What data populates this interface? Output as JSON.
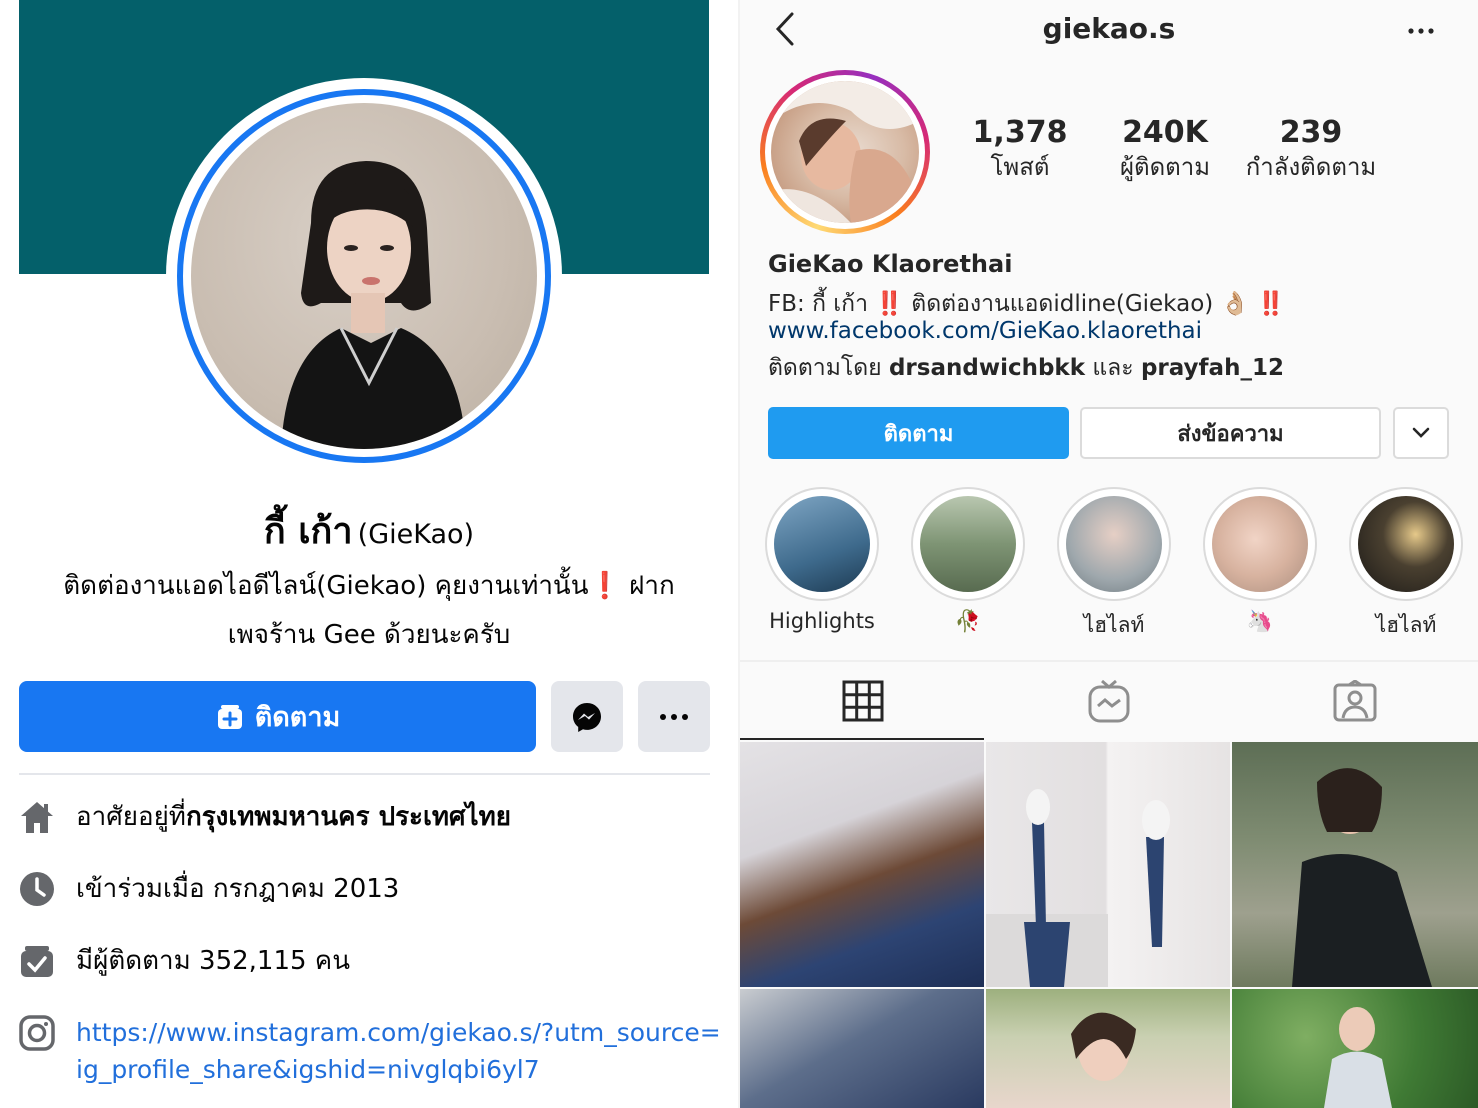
{
  "facebook": {
    "name_th": "กี้ เก้า",
    "name_en": "(GieKao)",
    "bio_line1": "ติดต่องานแอดไอดีไลน์(Giekao) คุยงานเท่านั้น❗ ฝาก",
    "bio_line2": "เพจร้าน Gee ด้วยนะครับ",
    "follow_label": "ติดตาม",
    "lives_prefix": "อาศัยอยู่ที่ ",
    "lives_place": "กรุงเทพมหานคร ประเทศไทย",
    "joined": "เข้าร่วมเมื่อ กรกฎาคม  2013",
    "followers": "มีผู้ติดตาม 352,115 คน",
    "instagram_link": "https://www.instagram.com/giekao.s/?utm_source=ig_profile_share&igshid=nivglqbi6yl7",
    "colors": {
      "cover": "#04606a",
      "accent": "#1877f2"
    }
  },
  "instagram": {
    "username": "giekao.s",
    "stats": [
      {
        "value": "1,378",
        "label": "โพสต์"
      },
      {
        "value": "240K",
        "label": "ผู้ติดตาม"
      },
      {
        "value": "239",
        "label": "กำลังติดตาม"
      }
    ],
    "display_name": "GieKao Klaorethai",
    "bio_prefix": "FB: กี้ เก้า ",
    "bio_bang1": "‼️",
    "bio_middle": " ติดต่องานแอดidline(Giekao) 👌🏼 ",
    "bio_bang2": "‼️",
    "url": "www.facebook.com/GieKao.klaorethai",
    "followed_prefix": "ติดตามโดย ",
    "followed_user1": "drsandwichbkk",
    "followed_and": " และ ",
    "followed_user2": "prayfah_12",
    "follow_label": "ติดตาม",
    "message_label": "ส่งข้อความ",
    "highlights": [
      {
        "label": "Highlights"
      },
      {
        "label": "🥀"
      },
      {
        "label": "ไฮไลท์"
      },
      {
        "label": "🦄"
      },
      {
        "label": "ไฮไลท์"
      }
    ],
    "colors": {
      "follow_button": "#1f9bf0",
      "link": "#00376b"
    }
  }
}
